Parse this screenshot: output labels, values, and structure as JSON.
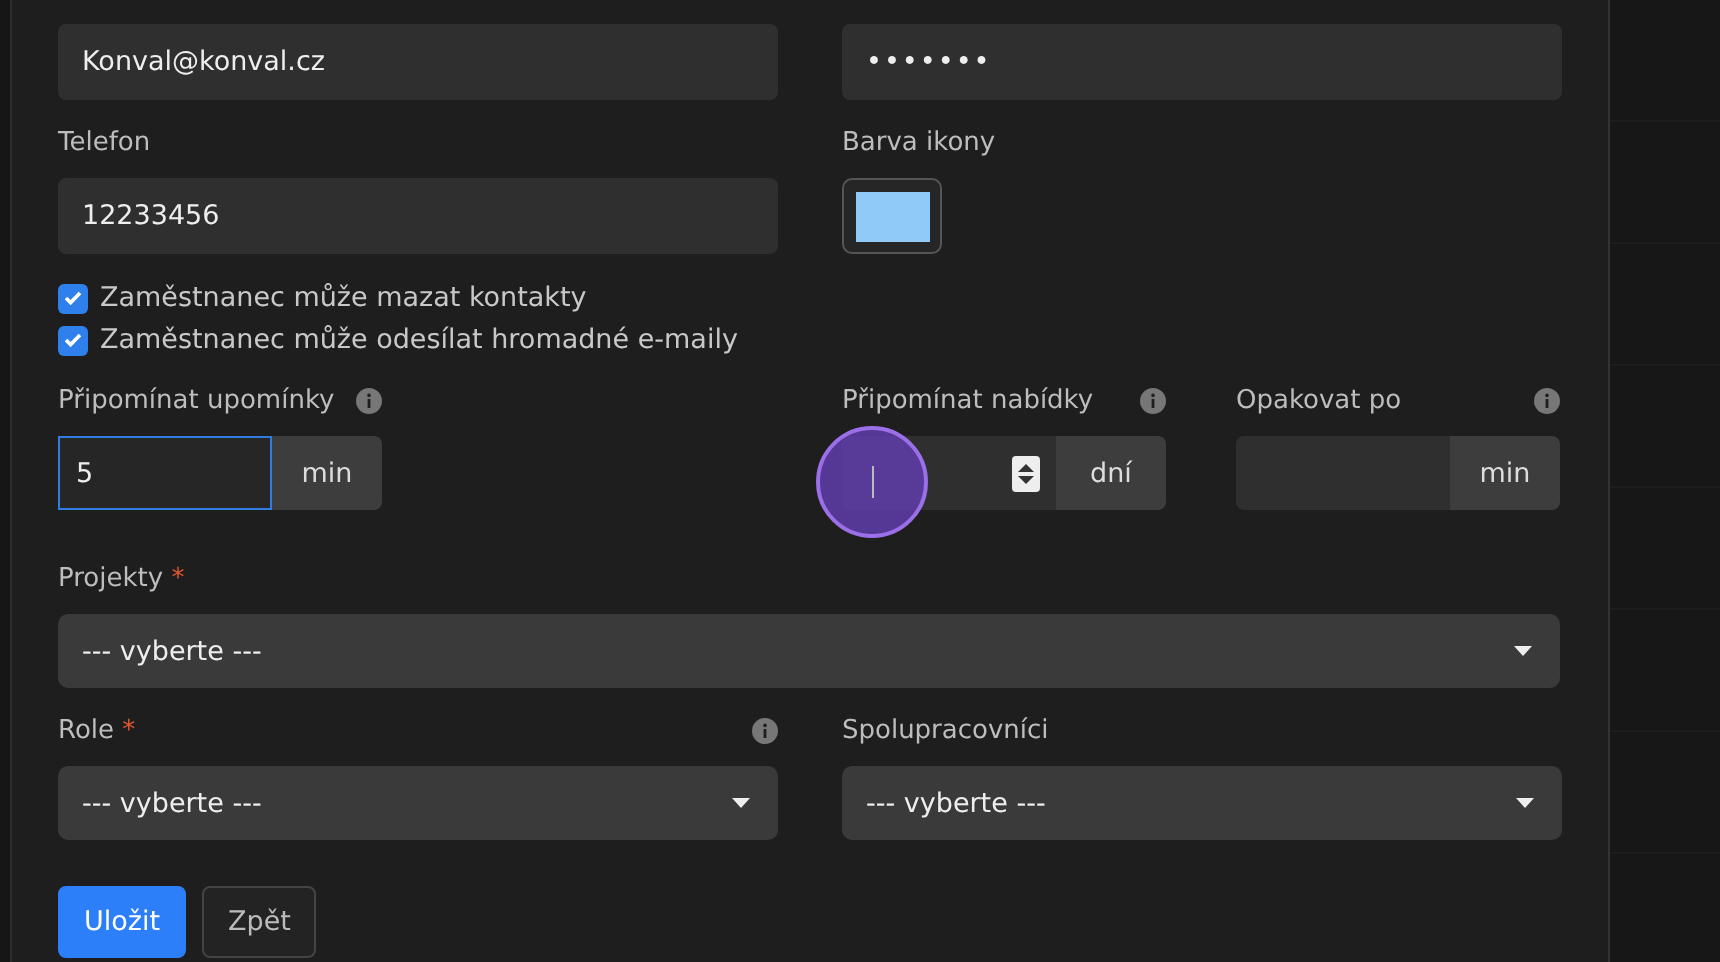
{
  "email": {
    "value": "Konval@konval.cz"
  },
  "password": {
    "value": "•••••••"
  },
  "phone": {
    "label": "Telefon",
    "value": "12233456"
  },
  "icon_color": {
    "label": "Barva ikony",
    "color": "#90caf9"
  },
  "checkboxes": [
    {
      "label": "Zaměstnanec může mazat kontakty",
      "checked": true
    },
    {
      "label": "Zaměstnanec může odesílat hromadné e-maily",
      "checked": true
    }
  ],
  "reminders": [
    {
      "label": "Připomínat upomínky",
      "value": "5",
      "unit": "min",
      "focused": true,
      "spinner": false
    },
    {
      "label": "Připomínat nabídky",
      "unit": "dní",
      "focused": false,
      "spinner": true
    },
    {
      "label": "Opakovat po",
      "unit": "min",
      "focused": false,
      "spinner": false
    }
  ],
  "projects": {
    "label": "Projekty",
    "required_mark": "*",
    "info": false,
    "value": "--- vyberte ---"
  },
  "selects": [
    {
      "label": "Role",
      "required_mark": "*",
      "info": true,
      "value": "--- vyberte ---"
    },
    {
      "label": "Spolupracovníci",
      "info": false,
      "value": "--- vyberte ---"
    }
  ],
  "buttons": [
    {
      "label": "Uložit",
      "kind": "primary"
    },
    {
      "label": "Zpět",
      "kind": "secondary"
    }
  ]
}
